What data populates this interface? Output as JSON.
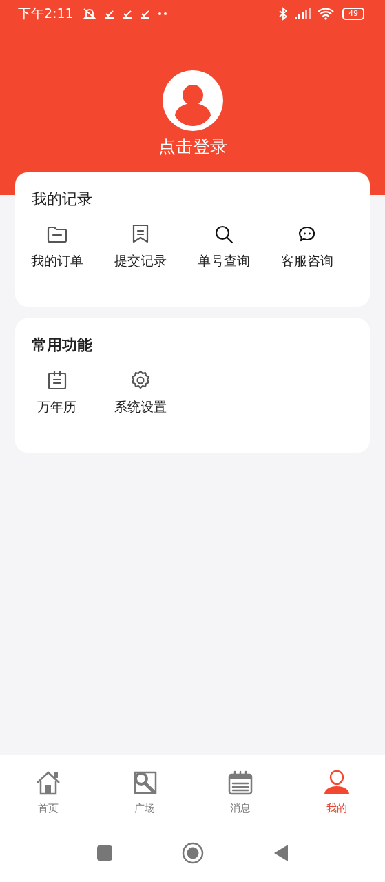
{
  "status_bar": {
    "time": "下午2:11",
    "battery": "49"
  },
  "profile": {
    "login_label": "点击登录"
  },
  "records": {
    "title": "我的记录",
    "items": [
      {
        "label": "我的订单"
      },
      {
        "label": "提交记录"
      },
      {
        "label": "单号查询"
      },
      {
        "label": "客服咨询"
      }
    ]
  },
  "common": {
    "title": "常用功能",
    "items": [
      {
        "label": "万年历"
      },
      {
        "label": "系统设置"
      }
    ]
  },
  "tabs": [
    {
      "label": "首页",
      "selected": false
    },
    {
      "label": "广场",
      "selected": false
    },
    {
      "label": "消息",
      "selected": false
    },
    {
      "label": "我的",
      "selected": true
    }
  ]
}
